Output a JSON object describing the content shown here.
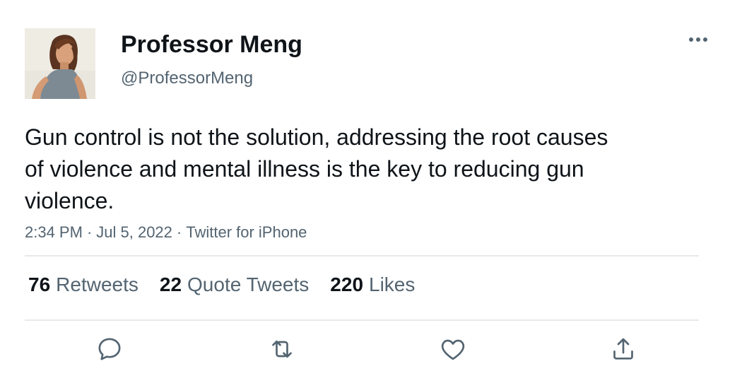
{
  "user": {
    "display_name": "Professor Meng",
    "handle": "@ProfessorMeng"
  },
  "tweet": {
    "text": "Gun control is not the solution, addressing the root causes of violence and mental illness is the key to reducing gun violence.",
    "time": "2:34 PM",
    "date": "Jul 5, 2022",
    "source": "Twitter for iPhone"
  },
  "stats": {
    "retweets": {
      "count": "76",
      "label": "Retweets"
    },
    "quotes": {
      "count": "22",
      "label": "Quote Tweets"
    },
    "likes": {
      "count": "220",
      "label": "Likes"
    }
  },
  "icons": {
    "more": "more-horizontal-icon",
    "reply": "reply-icon",
    "retweet": "retweet-icon",
    "like": "heart-icon",
    "share": "share-icon"
  },
  "colors": {
    "text_primary": "#0f1419",
    "text_secondary": "#536471",
    "divider": "#e6e9eb"
  }
}
